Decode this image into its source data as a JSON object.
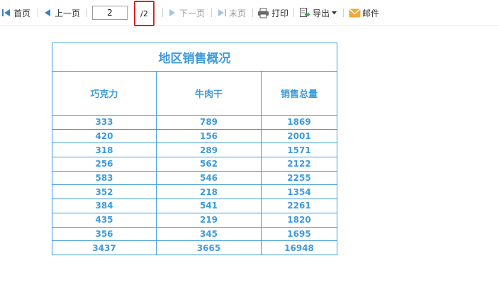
{
  "toolbar": {
    "first_label": "首页",
    "prev_label": "上一页",
    "page_value": "2",
    "total_pages": "/2",
    "next_label": "下一页",
    "last_label": "末页",
    "print_label": "打印",
    "export_label": "导出",
    "mail_label": "邮件",
    "icons": {
      "first": "first-page-icon",
      "prev": "prev-page-icon",
      "next": "next-page-icon",
      "last": "last-page-icon",
      "print": "printer-icon",
      "export": "export-icon",
      "dropdown": "caret-down-icon",
      "mail": "envelope-icon"
    }
  },
  "report": {
    "title": "地区销售概况",
    "headers": [
      "巧克力",
      "牛肉干",
      "销售总量"
    ],
    "rows": [
      [
        "333",
        "789",
        "1869"
      ],
      [
        "420",
        "156",
        "2001"
      ],
      [
        "318",
        "289",
        "1571"
      ],
      [
        "256",
        "562",
        "2122"
      ],
      [
        "583",
        "546",
        "2255"
      ],
      [
        "352",
        "218",
        "1354"
      ],
      [
        "384",
        "541",
        "2261"
      ],
      [
        "435",
        "219",
        "1820"
      ],
      [
        "356",
        "345",
        "1695"
      ],
      [
        "3437",
        "3665",
        "16948"
      ]
    ]
  },
  "colors": {
    "accent_blue": "#3d9bdc",
    "highlight_red": "#e0201e",
    "disabled_gray": "#9a9a9a",
    "mail_orange": "#f0a93c"
  }
}
